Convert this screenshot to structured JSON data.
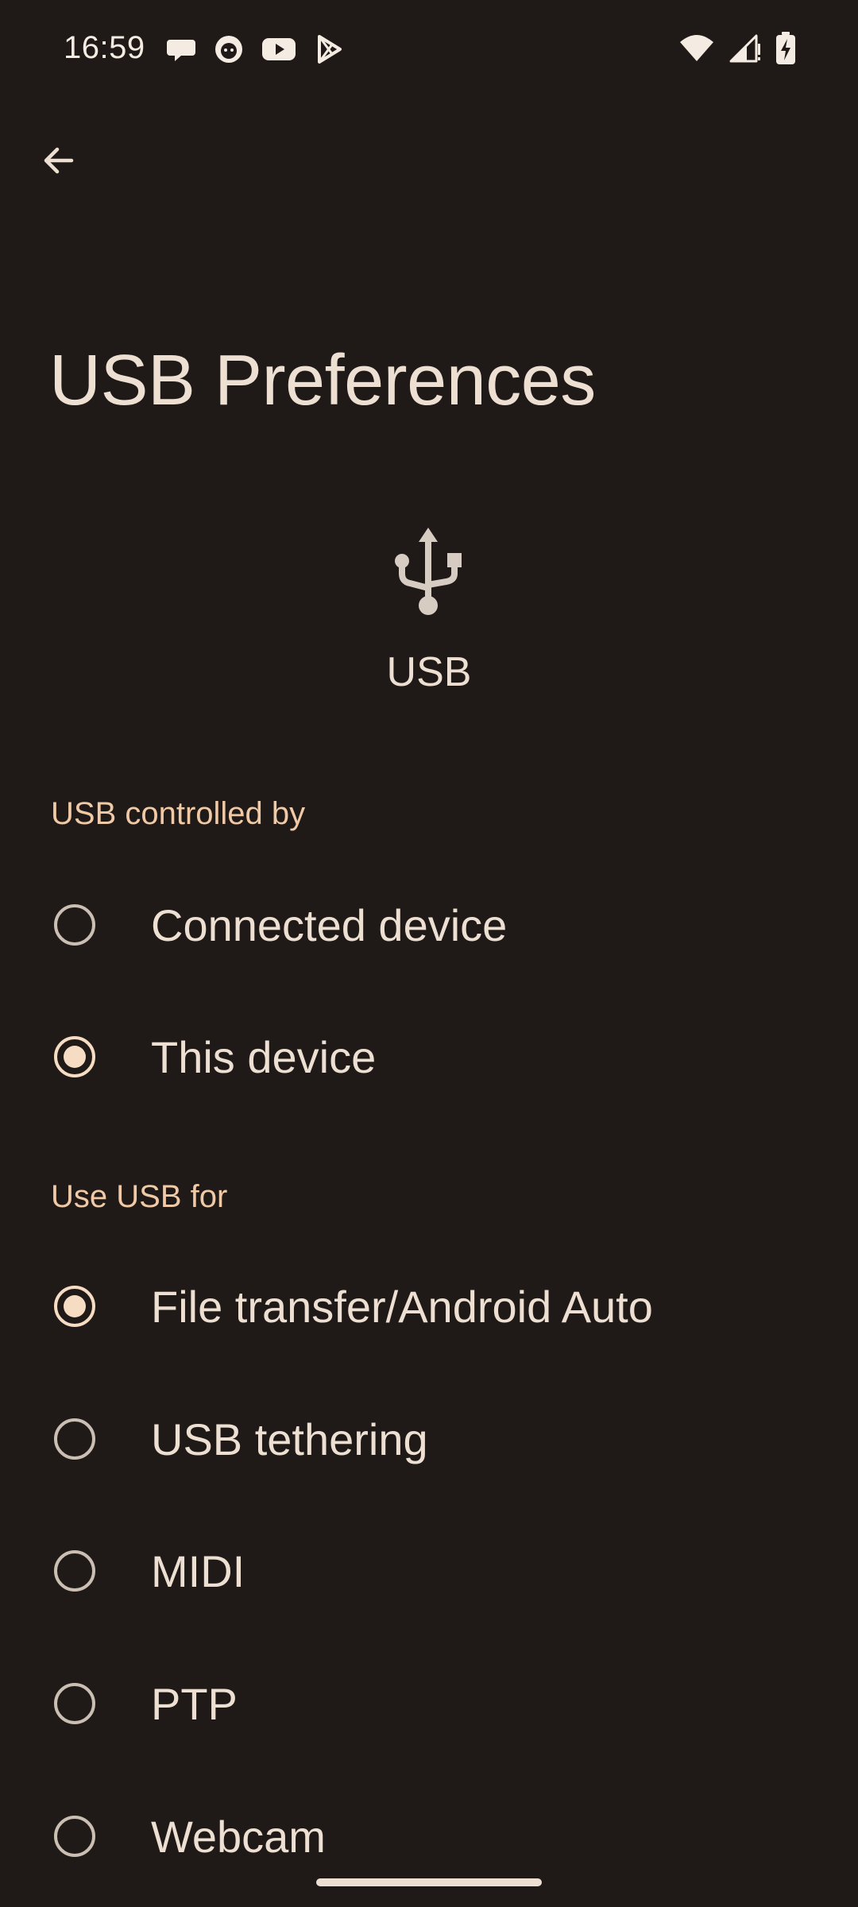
{
  "status_bar": {
    "time": "16:59",
    "notification_icons": [
      "chat-bubble-icon",
      "cat-face-icon",
      "youtube-icon",
      "play-store-icon"
    ],
    "system_icons": [
      "wifi-icon",
      "cellular-signal-icon",
      "battery-charging-icon"
    ]
  },
  "header": {
    "back_icon": "arrow-back-icon",
    "title": "USB Preferences"
  },
  "hero": {
    "icon": "usb-icon",
    "label": "USB"
  },
  "sections": [
    {
      "header": "USB controlled by",
      "options": [
        {
          "label": "Connected device",
          "selected": false
        },
        {
          "label": "This device",
          "selected": true
        }
      ]
    },
    {
      "header": "Use USB for",
      "options": [
        {
          "label": "File transfer/Android Auto",
          "selected": true
        },
        {
          "label": "USB tethering",
          "selected": false
        },
        {
          "label": "MIDI",
          "selected": false
        },
        {
          "label": "PTP",
          "selected": false
        },
        {
          "label": "Webcam",
          "selected": false
        }
      ]
    }
  ],
  "colors": {
    "background": "#1f1a17",
    "text": "#ede0d2",
    "accent": "#f0c9a6",
    "radio_selected": "#f6dcc2"
  }
}
